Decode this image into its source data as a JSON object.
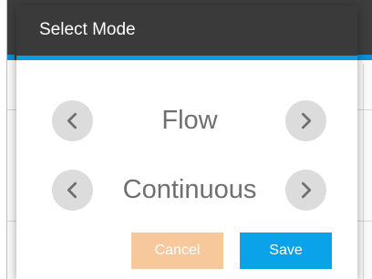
{
  "dialog": {
    "title": "Select Mode",
    "header_color": "#3a3a3a",
    "accent_color": "#0d9be3"
  },
  "modes": [
    {
      "value": "Flow",
      "prev_icon": "chevron-left-icon",
      "next_icon": "chevron-right-icon"
    },
    {
      "value": "Continuous",
      "prev_icon": "chevron-left-icon",
      "next_icon": "chevron-right-icon"
    }
  ],
  "actions": {
    "cancel_label": "Cancel",
    "cancel_color": "#f7c89b",
    "save_label": "Save",
    "save_color": "#0aa3ea"
  }
}
